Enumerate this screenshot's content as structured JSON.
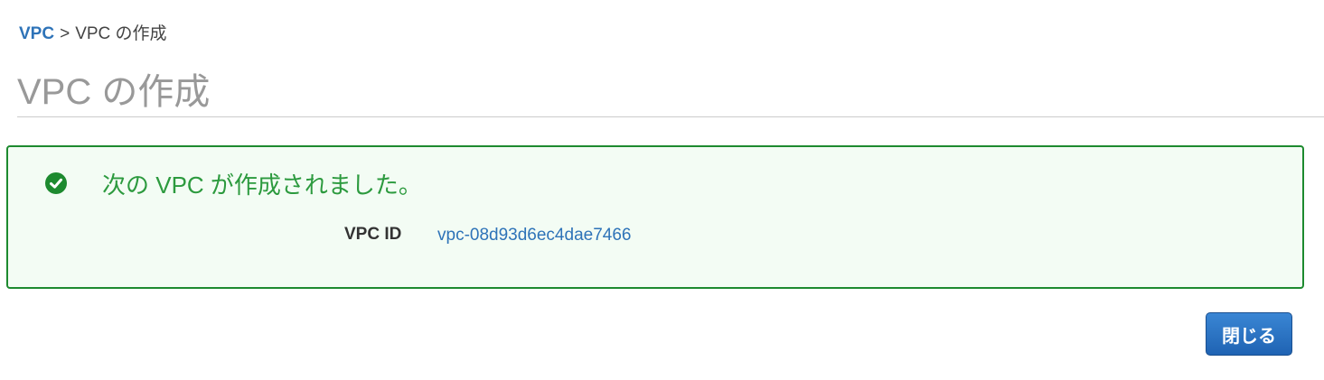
{
  "breadcrumb": {
    "parent": "VPC",
    "separator": ">",
    "current": "VPC の作成"
  },
  "page": {
    "title": "VPC の作成"
  },
  "alert": {
    "status": "success",
    "icon": "check-circle-icon",
    "message": "次の VPC が作成されました。",
    "details": [
      {
        "label": "VPC ID",
        "value": "vpc-08d93d6ec4dae7466"
      }
    ]
  },
  "actions": {
    "close_label": "閉じる"
  },
  "colors": {
    "link": "#2e73b8",
    "success": "#1d8a2f",
    "success_background": "#f3fcf4",
    "primary_button": "#1f63b3",
    "title": "#999999"
  }
}
